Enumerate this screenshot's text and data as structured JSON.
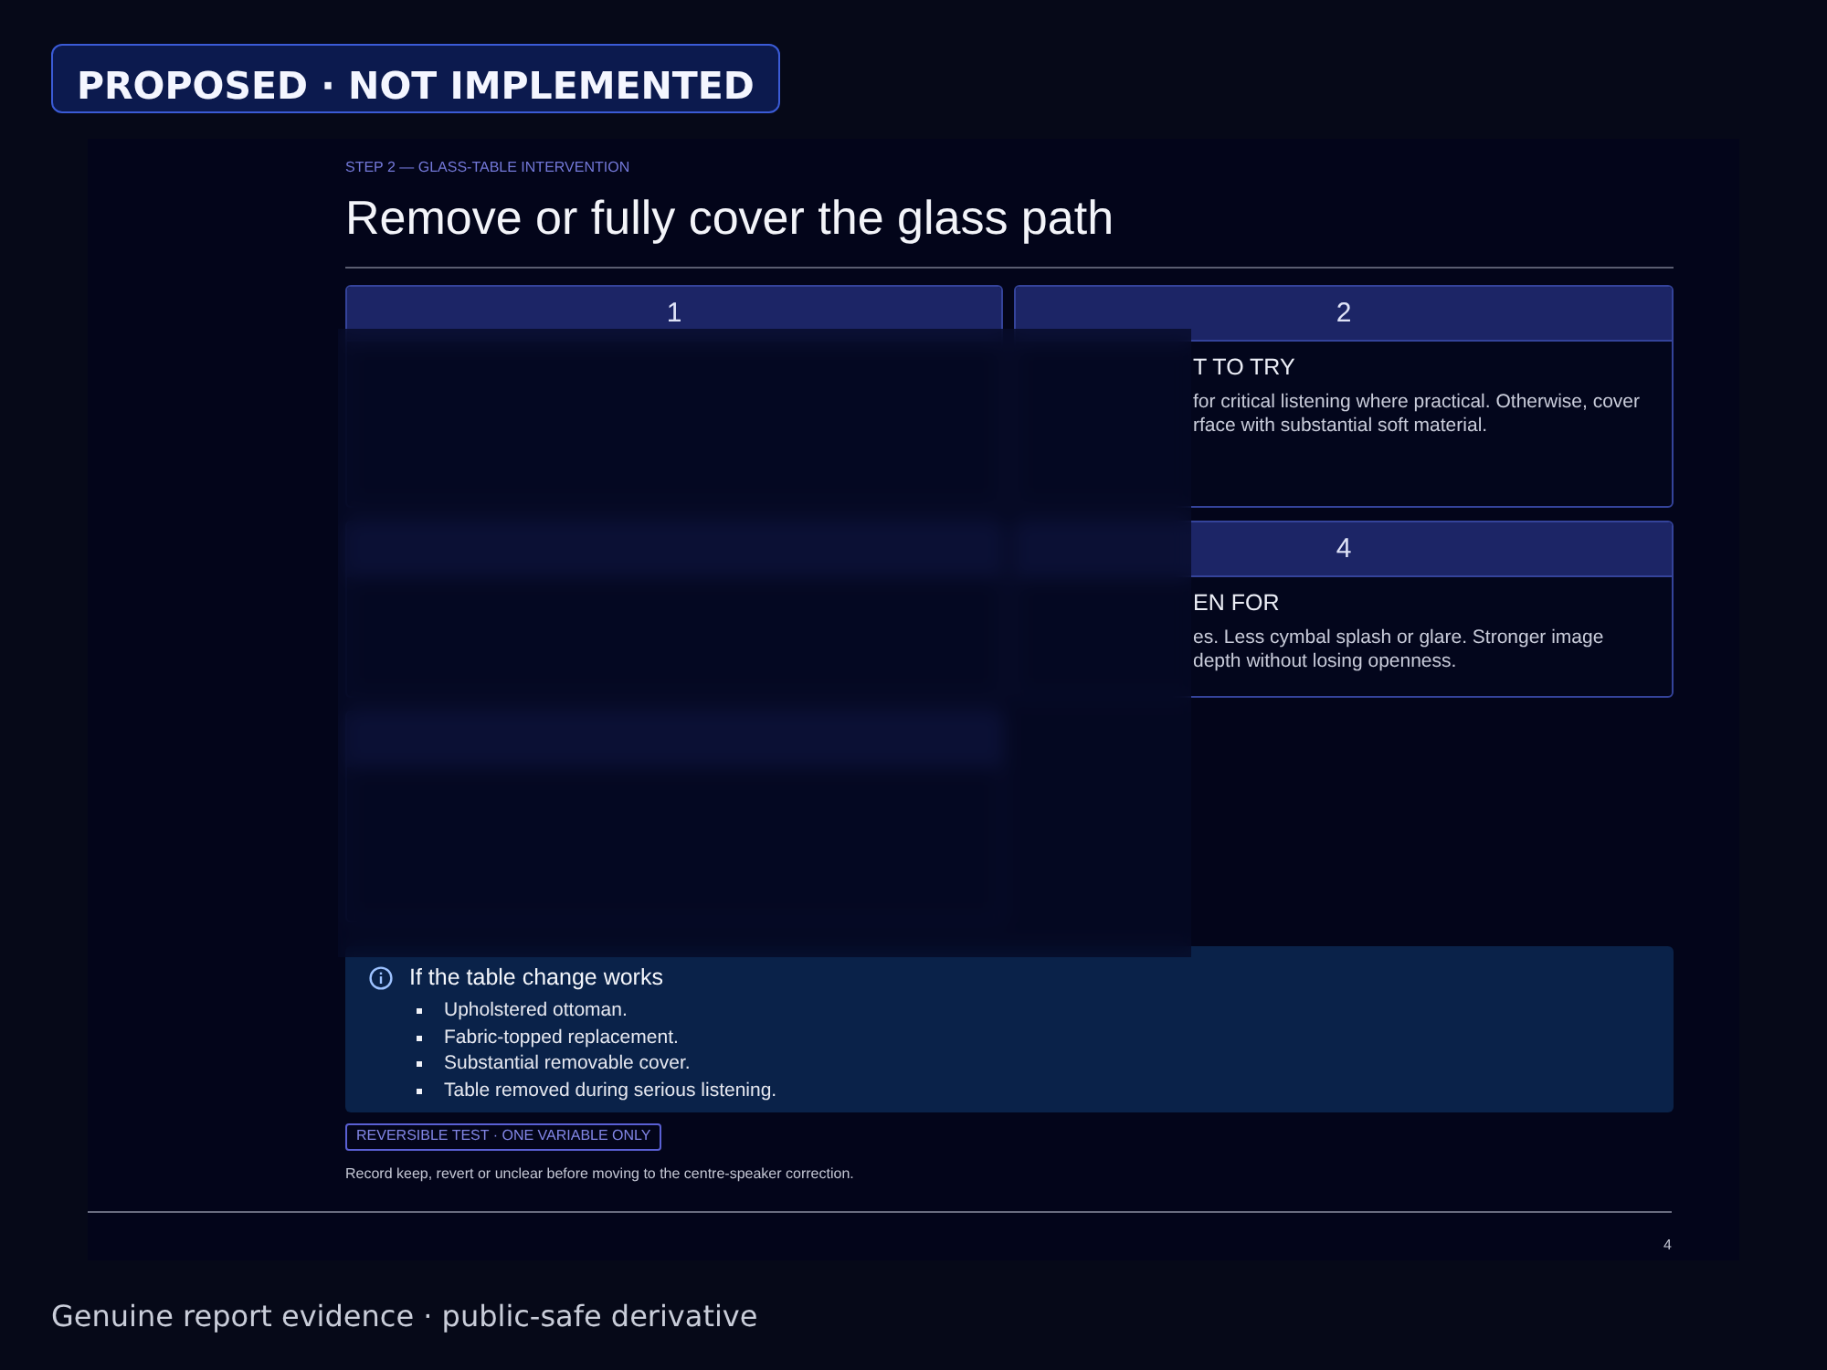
{
  "badge": {
    "label": "PROPOSED · NOT IMPLEMENTED"
  },
  "slide": {
    "eyebrow": "STEP 2 — GLASS-TABLE INTERVENTION",
    "title": "Remove or fully cover the glass path",
    "cards": [
      {
        "kind": "open",
        "number": "1"
      },
      {
        "kind": "open",
        "number": "2",
        "heading": "T TO TRY",
        "lines": [
          "for critical listening where practical. Otherwise, cover",
          "rface with substantial soft material."
        ]
      },
      {
        "kind": "covered"
      },
      {
        "kind": "open",
        "number": "4",
        "heading": "EN FOR",
        "lines": [
          "es. Less cymbal splash or glare. Stronger image",
          "depth without losing openness."
        ]
      },
      {
        "kind": "covered"
      }
    ],
    "callout": {
      "title": "If the table change works",
      "items": [
        "Upholstered ottoman.",
        "Fabric-topped replacement.",
        "Substantial removable cover.",
        "Table removed during serious listening."
      ]
    },
    "tag": "REVERSIBLE TEST · ONE VARIABLE ONLY",
    "note": "Record keep, revert or unclear before moving to the centre-speaker correction.",
    "page_number": "4"
  },
  "caption": "Genuine report evidence · public-safe derivative"
}
